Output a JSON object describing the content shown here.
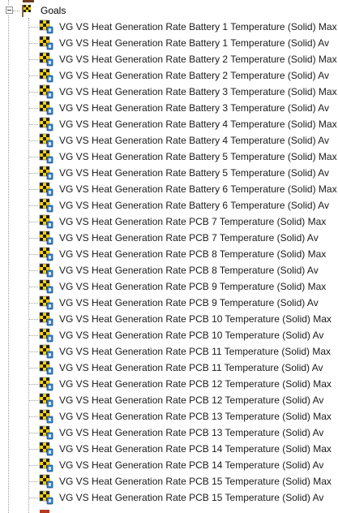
{
  "tree": {
    "root": {
      "label": "Goals",
      "icon": "goals-flag-icon",
      "expanded": true
    },
    "items": [
      {
        "label": "VG VS Heat Generation Rate Battery 1 Temperature (Solid) Max",
        "icon": "goal-checker-icon"
      },
      {
        "label": "VG VS Heat Generation Rate Battery 1 Temperature (Solid) Av",
        "icon": "goal-checker-icon"
      },
      {
        "label": "VG VS Heat Generation Rate Battery 2 Temperature (Solid) Max",
        "icon": "goal-checker-icon"
      },
      {
        "label": "VG VS Heat Generation Rate Battery 2 Temperature (Solid) Av",
        "icon": "goal-checker-icon"
      },
      {
        "label": "VG VS Heat Generation Rate Battery 3 Temperature (Solid) Max",
        "icon": "goal-checker-icon"
      },
      {
        "label": "VG VS Heat Generation Rate Battery 3 Temperature (Solid) Av",
        "icon": "goal-checker-icon"
      },
      {
        "label": "VG VS Heat Generation Rate Battery 4 Temperature (Solid) Max",
        "icon": "goal-checker-icon"
      },
      {
        "label": "VG VS Heat Generation Rate Battery 4 Temperature (Solid) Av",
        "icon": "goal-checker-icon"
      },
      {
        "label": "VG VS Heat Generation Rate Battery 5 Temperature (Solid) Max",
        "icon": "goal-checker-icon"
      },
      {
        "label": "VG VS Heat Generation Rate Battery 5 Temperature (Solid) Av",
        "icon": "goal-checker-icon"
      },
      {
        "label": "VG VS Heat Generation Rate Battery 6 Temperature (Solid) Max",
        "icon": "goal-checker-icon"
      },
      {
        "label": "VG VS Heat Generation Rate Battery 6 Temperature (Solid) Av",
        "icon": "goal-checker-icon"
      },
      {
        "label": "VG VS Heat Generation Rate PCB 7 Temperature (Solid) Max",
        "icon": "goal-checker-icon"
      },
      {
        "label": "VG VS Heat Generation Rate PCB 7 Temperature (Solid) Av",
        "icon": "goal-checker-icon"
      },
      {
        "label": "VG VS Heat Generation Rate PCB 8 Temperature (Solid) Max",
        "icon": "goal-checker-icon"
      },
      {
        "label": "VG VS Heat Generation Rate PCB 8 Temperature (Solid) Av",
        "icon": "goal-checker-icon"
      },
      {
        "label": "VG VS Heat Generation Rate PCB 9 Temperature (Solid) Max",
        "icon": "goal-checker-icon"
      },
      {
        "label": "VG VS Heat Generation Rate PCB 9 Temperature (Solid) Av",
        "icon": "goal-checker-icon"
      },
      {
        "label": "VG VS Heat Generation Rate PCB 10 Temperature (Solid) Max",
        "icon": "goal-checker-icon"
      },
      {
        "label": "VG VS Heat Generation Rate PCB 10 Temperature (Solid) Av",
        "icon": "goal-checker-icon"
      },
      {
        "label": "VG VS Heat Generation Rate PCB 11 Temperature (Solid) Max",
        "icon": "goal-checker-icon"
      },
      {
        "label": "VG VS Heat Generation Rate PCB 11 Temperature (Solid) Av",
        "icon": "goal-checker-icon"
      },
      {
        "label": "VG VS Heat Generation Rate PCB 12 Temperature (Solid) Max",
        "icon": "goal-checker-icon"
      },
      {
        "label": "VG VS Heat Generation Rate PCB 12 Temperature (Solid) Av",
        "icon": "goal-checker-icon"
      },
      {
        "label": "VG VS Heat Generation Rate PCB 13 Temperature (Solid) Max",
        "icon": "goal-checker-icon"
      },
      {
        "label": "VG VS Heat Generation Rate PCB 13 Temperature (Solid) Av",
        "icon": "goal-checker-icon"
      },
      {
        "label": "VG VS Heat Generation Rate PCB 14 Temperature (Solid) Max",
        "icon": "goal-checker-icon"
      },
      {
        "label": "VG VS Heat Generation Rate PCB 14 Temperature (Solid) Av",
        "icon": "goal-checker-icon"
      },
      {
        "label": "VG VS Heat Generation Rate PCB 15 Temperature (Solid) Max",
        "icon": "goal-checker-icon"
      },
      {
        "label": "VG VS Heat Generation Rate PCB 15 Temperature (Solid) Av",
        "icon": "goal-checker-icon"
      }
    ]
  }
}
